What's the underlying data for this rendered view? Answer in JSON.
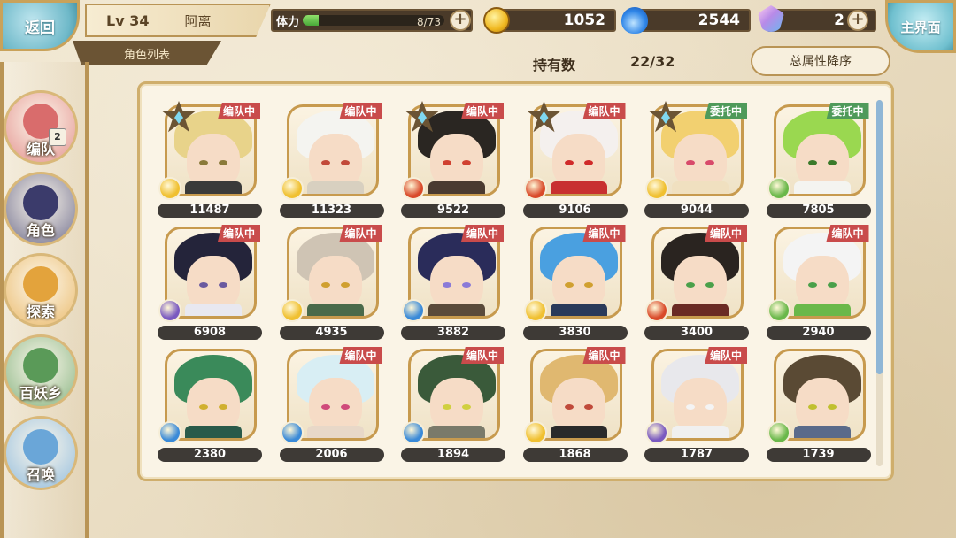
{
  "header": {
    "back_label": "返回",
    "level_label": "Lv 34",
    "player_name": "阿离",
    "subtitle": "角色列表",
    "stamina_label": "体力",
    "stamina_count": "8/73",
    "stamina_fraction": 0.11,
    "gold_amount": "1052",
    "soul_amount": "2544",
    "crystal_amount": "2",
    "home_label": "主界面"
  },
  "nav": {
    "items": [
      {
        "label": "编队",
        "badge": "2",
        "color": "#d96c6c"
      },
      {
        "label": "角色",
        "color": "#3b3b6b"
      },
      {
        "label": "探索",
        "color": "#e3a33c"
      },
      {
        "label": "百妖乡",
        "color": "#5a9a58"
      },
      {
        "label": "召唤",
        "color": "#6aa6d8"
      }
    ]
  },
  "list": {
    "owned_label": "持有数",
    "owned_count": "22/32",
    "sort_label": "总属性降序"
  },
  "characters": [
    {
      "power": "11487",
      "tag": "编队中",
      "tag_type": "team",
      "rank": true,
      "hair": "#e8d38a",
      "eye": "#8a7a3a",
      "element": "#f0c030",
      "collar": "#3a3a3a"
    },
    {
      "power": "11323",
      "tag": "编队中",
      "tag_type": "team",
      "rank": false,
      "hair": "#f4f4f0",
      "eye": "#c24a3a",
      "element": "#f0c030",
      "collar": "#d8d0c0"
    },
    {
      "power": "9522",
      "tag": "编队中",
      "tag_type": "team",
      "rank": true,
      "hair": "#2a2622",
      "eye": "#d04030",
      "element": "#d94a2a",
      "collar": "#4a3a30"
    },
    {
      "power": "9106",
      "tag": "编队中",
      "tag_type": "team",
      "rank": true,
      "hair": "#f4f0ee",
      "eye": "#d02a2a",
      "element": "#d94a2a",
      "collar": "#c83030"
    },
    {
      "power": "9044",
      "tag": "委托中",
      "tag_type": "commission",
      "rank": true,
      "hair": "#f2d070",
      "eye": "#d84a6a",
      "element": "#f0c030",
      "collar": "#f0e0c0"
    },
    {
      "power": "7805",
      "tag": "委托中",
      "tag_type": "commission",
      "rank": false,
      "hair": "#9ad850",
      "eye": "#3a7a2a",
      "element": "#6ab84a",
      "collar": "#f4f4f0"
    },
    {
      "power": "6908",
      "tag": "编队中",
      "tag_type": "team",
      "rank": false,
      "hair": "#24243a",
      "eye": "#6a5aa0",
      "element": "#7a5ac0",
      "collar": "#e8e8f0"
    },
    {
      "power": "4935",
      "tag": "编队中",
      "tag_type": "team",
      "rank": false,
      "hair": "#cfc4b4",
      "eye": "#d0a030",
      "element": "#f0c030",
      "collar": "#4a6a4a"
    },
    {
      "power": "3882",
      "tag": "编队中",
      "tag_type": "team",
      "rank": false,
      "hair": "#2a2c5a",
      "eye": "#8a7ad8",
      "element": "#3a8ad8",
      "collar": "#5a4a3a"
    },
    {
      "power": "3830",
      "tag": "编队中",
      "tag_type": "team",
      "rank": false,
      "hair": "#4aa0e0",
      "eye": "#d0a030",
      "element": "#f0c030",
      "collar": "#2a3a5a"
    },
    {
      "power": "3400",
      "tag": "编队中",
      "tag_type": "team",
      "rank": false,
      "hair": "#2a2420",
      "eye": "#4aa04a",
      "element": "#d94a2a",
      "collar": "#6a2a24"
    },
    {
      "power": "2940",
      "tag": "编队中",
      "tag_type": "team",
      "rank": false,
      "hair": "#f4f4f4",
      "eye": "#4aa04a",
      "element": "#6ab84a",
      "collar": "#6ab84a"
    },
    {
      "power": "2380",
      "tag": "",
      "tag_type": "",
      "rank": false,
      "hair": "#3a8a5a",
      "eye": "#d0b030",
      "element": "#3a8ad8",
      "collar": "#2a5a4a"
    },
    {
      "power": "2006",
      "tag": "编队中",
      "tag_type": "team",
      "rank": false,
      "hair": "#d8eef4",
      "eye": "#d04a7a",
      "element": "#3a8ad8",
      "collar": "#e8d8c8"
    },
    {
      "power": "1894",
      "tag": "编队中",
      "tag_type": "team",
      "rank": false,
      "hair": "#3a5a3a",
      "eye": "#d0d040",
      "element": "#3a8ad8",
      "collar": "#7a7a6a"
    },
    {
      "power": "1868",
      "tag": "编队中",
      "tag_type": "team",
      "rank": false,
      "hair": "#e0b870",
      "eye": "#c04a3a",
      "element": "#f0c030",
      "collar": "#2a2a2a"
    },
    {
      "power": "1787",
      "tag": "编队中",
      "tag_type": "team",
      "rank": false,
      "hair": "#e8e8ec",
      "eye": "#f4f4f4",
      "element": "#7a5ac0",
      "collar": "#f0f0f0"
    },
    {
      "power": "1739",
      "tag": "",
      "tag_type": "",
      "rank": false,
      "hair": "#5a4a34",
      "eye": "#c0c030",
      "element": "#6ab84a",
      "collar": "#5a6a8a"
    }
  ]
}
